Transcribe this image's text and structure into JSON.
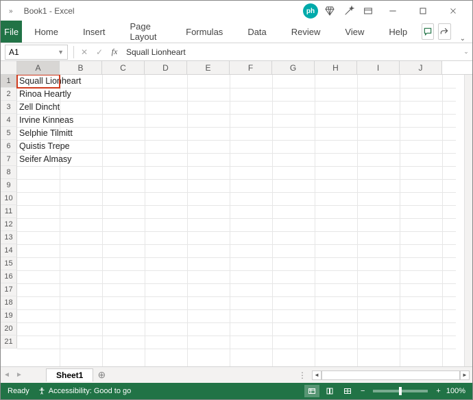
{
  "title": "Book1 - Excel",
  "ribbon": {
    "file": "File",
    "tabs": [
      "Home",
      "Insert",
      "Page Layout",
      "Formulas",
      "Data",
      "Review",
      "View",
      "Help"
    ]
  },
  "namebox": "A1",
  "formula": "Squall Lionheart",
  "columns": [
    "A",
    "B",
    "C",
    "D",
    "E",
    "F",
    "G",
    "H",
    "I",
    "J"
  ],
  "rows": [
    "1",
    "2",
    "3",
    "4",
    "5",
    "6",
    "7",
    "8",
    "9",
    "10",
    "11",
    "12",
    "13",
    "14",
    "15",
    "16",
    "17",
    "18",
    "19",
    "20",
    "21"
  ],
  "cellData": {
    "A1": "Squall Lionheart",
    "A2": "Rinoa Heartly",
    "A3": "Zell Dincht",
    "A4": "Irvine Kinneas",
    "A5": "Selphie Tilmitt",
    "A6": "Quistis Trepe",
    "A7": "Seifer Almasy"
  },
  "sheets": {
    "active": "Sheet1"
  },
  "status": {
    "ready": "Ready",
    "accessibility": "Accessibility: Good to go",
    "zoom": "100%"
  }
}
